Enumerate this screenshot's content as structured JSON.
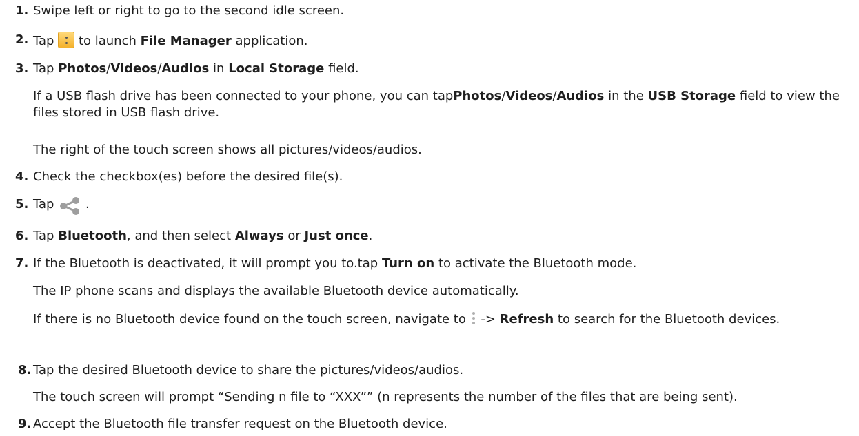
{
  "steps": [
    {
      "num": "1.",
      "text": "Swipe left or right to go to the second idle screen."
    },
    {
      "num": "2.",
      "pre": "Tap",
      "mid": "to launch",
      "bold": "File Manager",
      "post": "application."
    },
    {
      "num": "3.",
      "pre": "Tap",
      "b1": "Photos",
      "s1": "/",
      "b2": "Videos",
      "s2": "/",
      "b3": "Audios",
      "mid": "in",
      "b4": "Local Storage",
      "post": "field."
    },
    {
      "num": "4.",
      "text": "Check the checkbox(es) before the desired file(s)."
    },
    {
      "num": "5.",
      "pre": "Tap",
      "post": "."
    },
    {
      "num": "6.",
      "pre": "Tap",
      "b1": "Bluetooth",
      "mid": ", and then select",
      "b2": "Always",
      "or": "or",
      "b3": "Just once",
      "post": "."
    },
    {
      "num": "7.",
      "pre": "If the Bluetooth is deactivated, it will prompt you to.tap",
      "bold": "Turn on",
      "post": "to activate the Bluetooth mode."
    },
    {
      "num": "8.",
      "text": "Tap the desired Bluetooth device to share the pictures/videos/audios."
    },
    {
      "num": "9.",
      "text": "Accept the Bluetooth file transfer request on the Bluetooth device."
    }
  ],
  "notes": {
    "usb_pre": "If a USB flash drive has been connected to your phone, you can tap",
    "usb_b1": "Photos",
    "usb_s1": "/",
    "usb_b2": "Videos",
    "usb_s2": "/",
    "usb_b3": "Audios",
    "usb_mid": "in the",
    "usb_b4": "USB Storage",
    "usb_post": "field to view the files stored in USB flash drive.",
    "right_show": "The right of the touch screen shows all pictures/videos/audios.",
    "scan": "The IP phone scans and displays the available Bluetooth device automatically.",
    "no_dev_pre": "If there is no Bluetooth device found on the touch screen, navigate to",
    "no_dev_arrow": "->",
    "no_dev_bold": "Refresh",
    "no_dev_post": "to search for the Bluetooth devices.",
    "sending": "The touch screen will prompt “Sending n file to “XXX”” (n represents the number of the files that are being sent)."
  },
  "icons": {
    "file_manager": "file-manager-icon",
    "share": "share-icon",
    "menu": "more-vertical-icon"
  },
  "colors": {
    "text": "#1f1f1f",
    "file_manager_icon": "#f4b12c",
    "share_icon": "#9e9e9e"
  }
}
